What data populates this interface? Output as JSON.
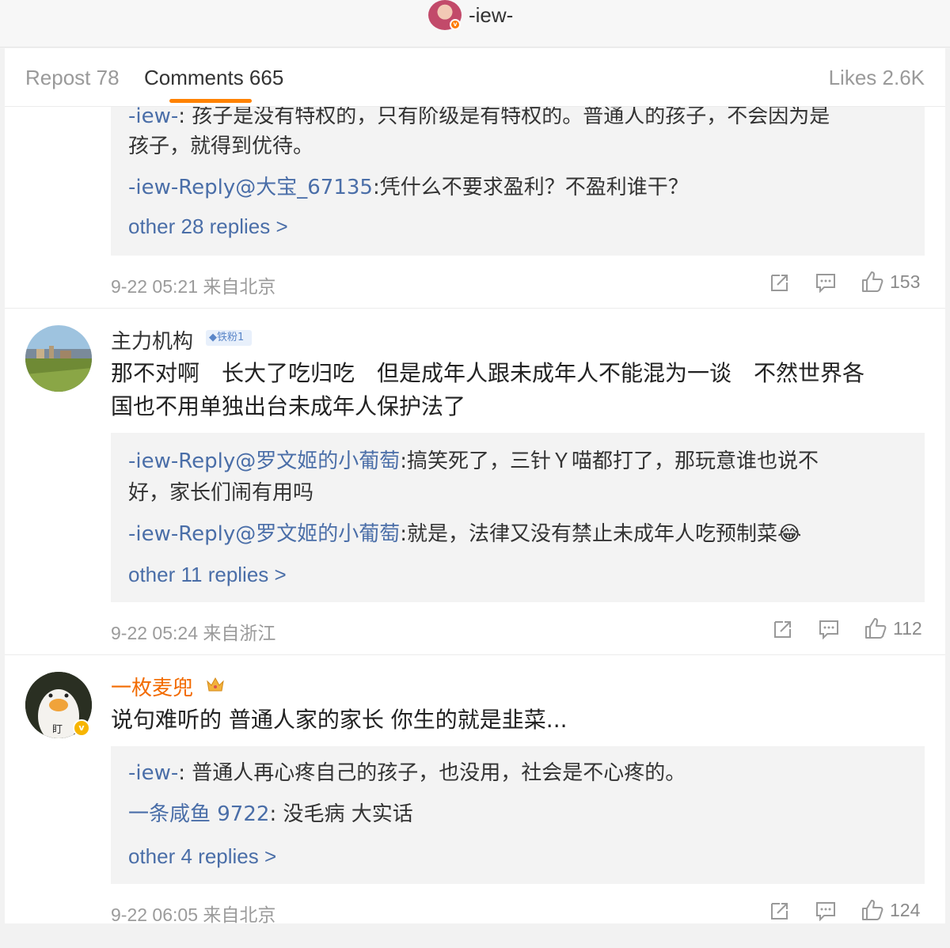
{
  "header": {
    "username": "-iew-",
    "verified_mark": "v"
  },
  "tabs": [
    {
      "label": "Repost 78"
    },
    {
      "label": "Comments 665"
    },
    {
      "label": "Likes 2.6K"
    }
  ],
  "comments": [
    {
      "replies": [
        {
          "user": "-iew-",
          "text": ": 孩子是没有特权的，只有阶级是有特权的。普通人的孩子，不会因为是",
          "text_cont": "孩子，就得到优待。"
        },
        {
          "user": "-iew-Reply@大宝_67135",
          "text": ":凭什么不要求盈利？不盈利谁干？"
        }
      ],
      "more_replies": "other 28 replies >",
      "time": "9-22 05:21 来自北京",
      "like_count": "153"
    },
    {
      "user": "主力机构",
      "badge": "铁粉1",
      "text_line1": "那不对啊　长大了吃归吃　但是成年人跟未成年人不能混为一谈　不然世界各",
      "text_line2": "国也不用单独出台未成年人保护法了",
      "replies": [
        {
          "user_prefix": "-iew-Reply",
          "user_mention": "@罗文姬的小葡萄",
          "text": ":搞笑死了，三针Ｙ喵都打了，那玩意谁也说不",
          "text_cont": "好，家长们闹有用吗"
        },
        {
          "user_prefix": "-iew-Reply",
          "user_mention": "@罗文姬的小葡萄",
          "text": ":就是，法律又没有禁止未成年人吃预制菜",
          "emoji": "😂"
        }
      ],
      "more_replies": "other 11 replies >",
      "time": "9-22 05:24 来自浙江",
      "like_count": "112"
    },
    {
      "user": "一枚麦兜",
      "avatar_text": "盯",
      "verified_mark": "v",
      "text_line1": "说句难听的 普通人家的家长 你生的就是韭菜...",
      "replies": [
        {
          "user": "-iew-",
          "text": ": 普通人再心疼自己的孩子，也没用，社会是不心疼的。"
        },
        {
          "user": "一条咸鱼 9722",
          "text": ": 没毛病 大实话"
        }
      ],
      "more_replies": "other 4 replies >",
      "time": "9-22 06:05 来自北京",
      "like_count": "124"
    }
  ],
  "icons": {
    "share": "share-icon",
    "comment": "comment-icon",
    "like": "thumbs-up-icon"
  },
  "colors": {
    "accent": "#ff8200",
    "link": "#4a6ea8",
    "vip_name": "#f26b00"
  }
}
